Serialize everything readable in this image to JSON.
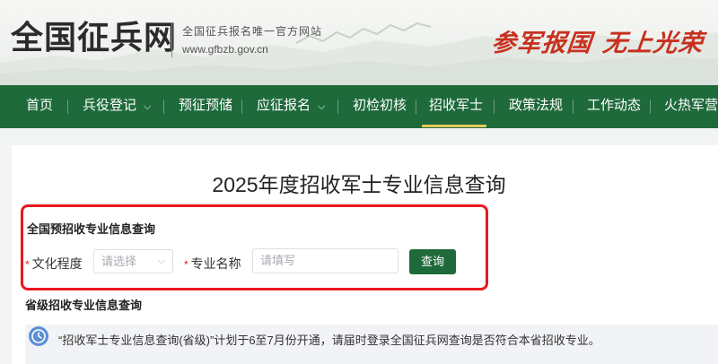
{
  "site": {
    "logo": "全国征兵网",
    "subtitle": "全国征兵报名唯一官方网站",
    "url": "www.gfbzb.gov.cn",
    "slogan_left": "参军报国",
    "slogan_right": "无上光荣"
  },
  "nav": {
    "items": [
      {
        "label": "首页"
      },
      {
        "label": "兵役登记",
        "dropdown": true
      },
      {
        "label": "预征预储"
      },
      {
        "label": "应征报名",
        "dropdown": true
      },
      {
        "label": "初检初核"
      },
      {
        "label": "招收军士",
        "active": true
      },
      {
        "label": "政策法规"
      },
      {
        "label": "工作动态"
      },
      {
        "label": "火热军营"
      }
    ],
    "chevron": "⌵"
  },
  "page": {
    "title": "2025年度招收军士专业信息查询"
  },
  "national": {
    "title": "全国预招收专业信息查询",
    "required_mark": "*",
    "education_label": "文化程度",
    "education_placeholder": "请选择",
    "major_label": "专业名称",
    "major_placeholder": "请填写",
    "query_button": "查询"
  },
  "provincial": {
    "title": "省级招收专业信息查询",
    "notice": "“招收军士专业信息查询(省级)”计划于6至7月份开通，请届时登录全国征兵网查询是否符合本省招收专业。"
  },
  "colors": {
    "nav_bg": "#1e6a3b",
    "accent_red": "#e8191e",
    "slogan_red": "#c8301e",
    "button_green": "#1e6a3b",
    "active_underline": "#e7c85a",
    "clock_icon": "#5b8fd6"
  },
  "icons": {
    "select_arrow": "chevron-down-icon",
    "notice_icon": "clock-icon"
  }
}
